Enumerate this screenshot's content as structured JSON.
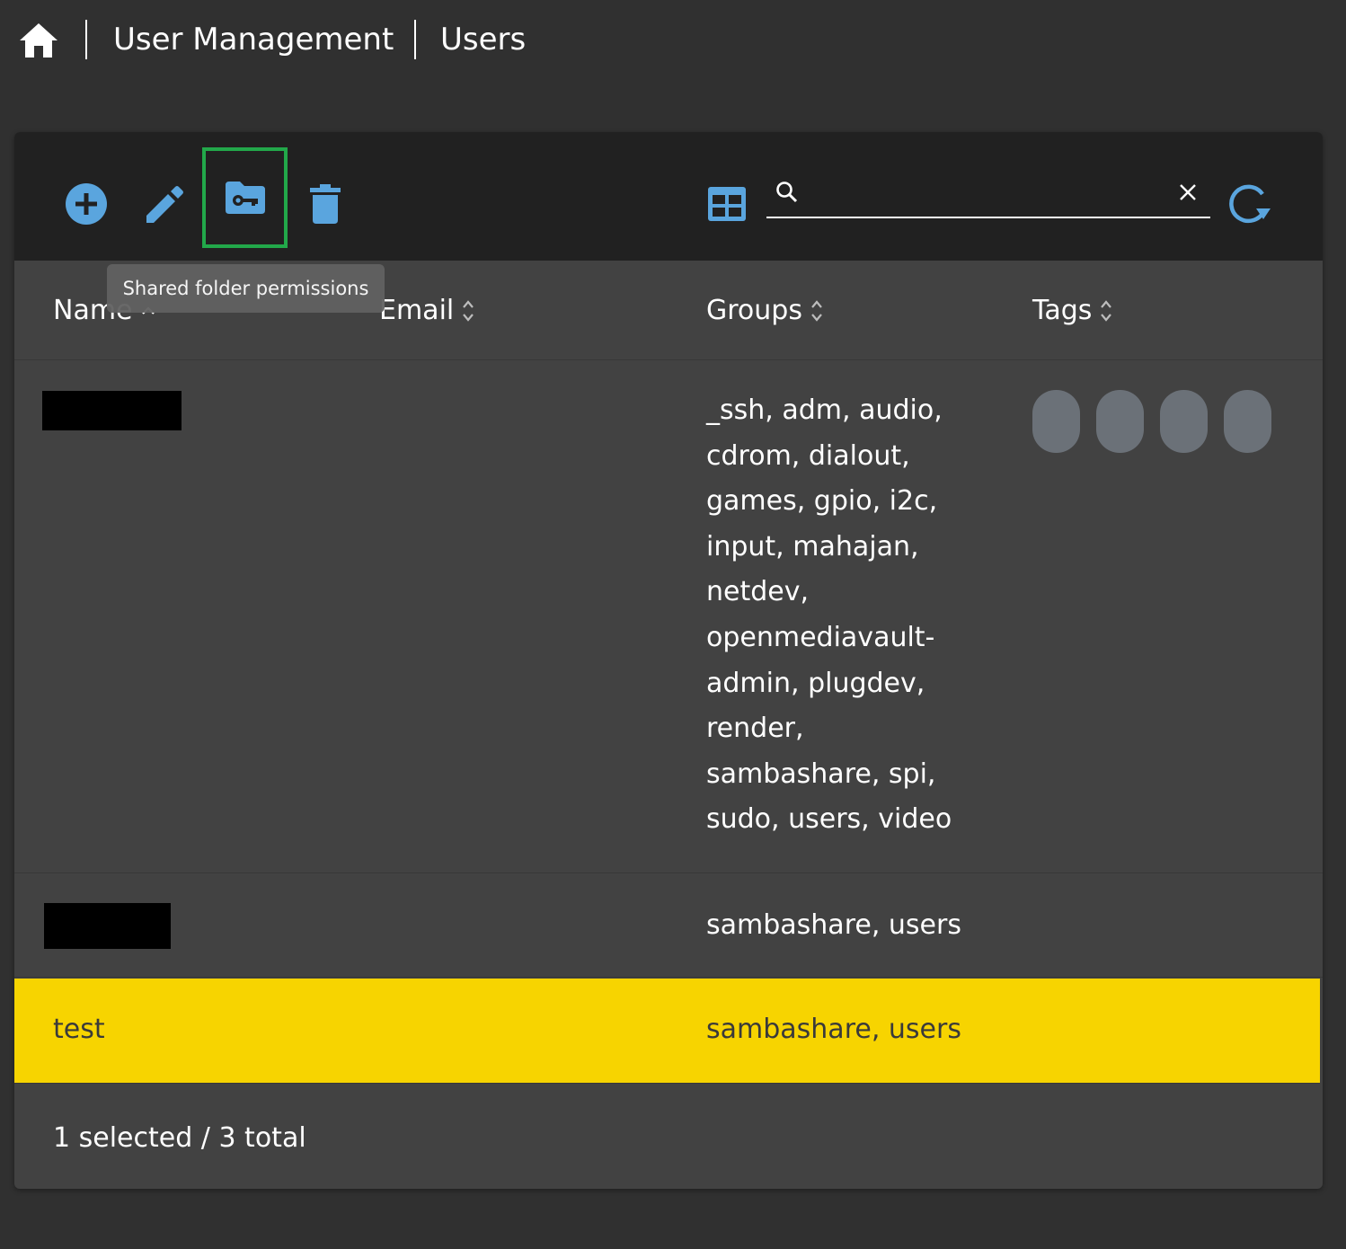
{
  "breadcrumb": {
    "items": [
      "User Management",
      "Users"
    ]
  },
  "toolbar": {
    "tools": [
      "add-circle-icon",
      "pencil-icon",
      "folder-key-icon",
      "trash-icon"
    ],
    "highlighted_tool": "folder-key-icon",
    "view_toggle": "table-icon",
    "search": {
      "value": "",
      "placeholder": ""
    },
    "refresh": "refresh-icon"
  },
  "tooltip": {
    "text": "Shared folder permissions"
  },
  "table": {
    "columns": [
      {
        "label": "Name",
        "sort": "ascending"
      },
      {
        "label": "Email",
        "sort": "none"
      },
      {
        "label": "Groups",
        "sort": "none"
      },
      {
        "label": "Tags",
        "sort": "none"
      }
    ],
    "rows": [
      {
        "name": "",
        "name_redacted": true,
        "email": "",
        "groups": "_ssh, adm, audio, cdrom, dialout, games, gpio, i2c, input, mahajan, netdev, openmediavault-admin, plugdev, render, sambashare, spi, sudo, users, video",
        "tags_count": 4,
        "selected": false
      },
      {
        "name": "",
        "name_redacted": true,
        "email": "",
        "groups": "sambashare, users",
        "tags_count": 0,
        "selected": false
      },
      {
        "name": "test",
        "name_redacted": false,
        "email": "",
        "groups": "sambashare, users",
        "tags_count": 0,
        "selected": true
      }
    ]
  },
  "footer": {
    "status": "1 selected / 3 total"
  },
  "colors": {
    "background": "#303030",
    "card": "#424242",
    "toolbar": "#212121",
    "accent": "#5aa5de",
    "selected_row": "#f7d400",
    "highlight_outline": "#22a84a",
    "tag_pill": "#6b7178"
  }
}
